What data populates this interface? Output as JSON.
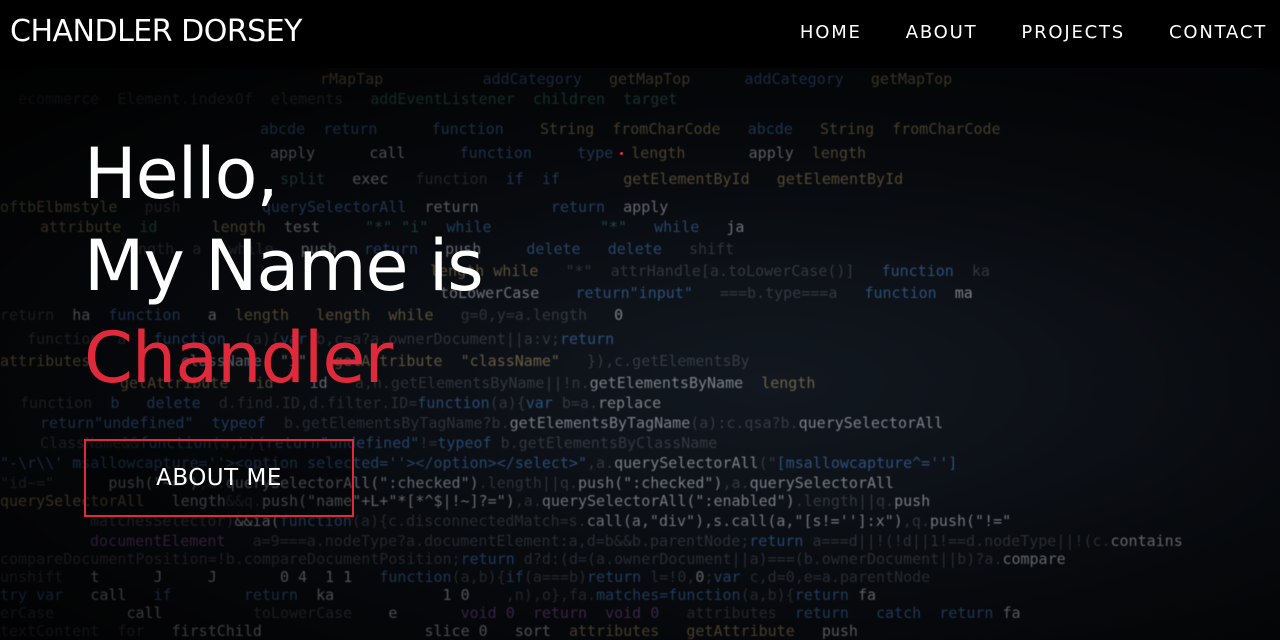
{
  "nav": {
    "brand": "CHANDLER DORSEY",
    "links": [
      "HOME",
      "ABOUT",
      "PROJECTS",
      "CONTACT"
    ]
  },
  "hero": {
    "line1": "Hello,",
    "line2": "My Name is",
    "name": "Chandler",
    "button_label": "ABOUT ME"
  },
  "colors": {
    "accent": "#e02a3c",
    "nav_bg": "#000000",
    "text": "#ffffff"
  }
}
